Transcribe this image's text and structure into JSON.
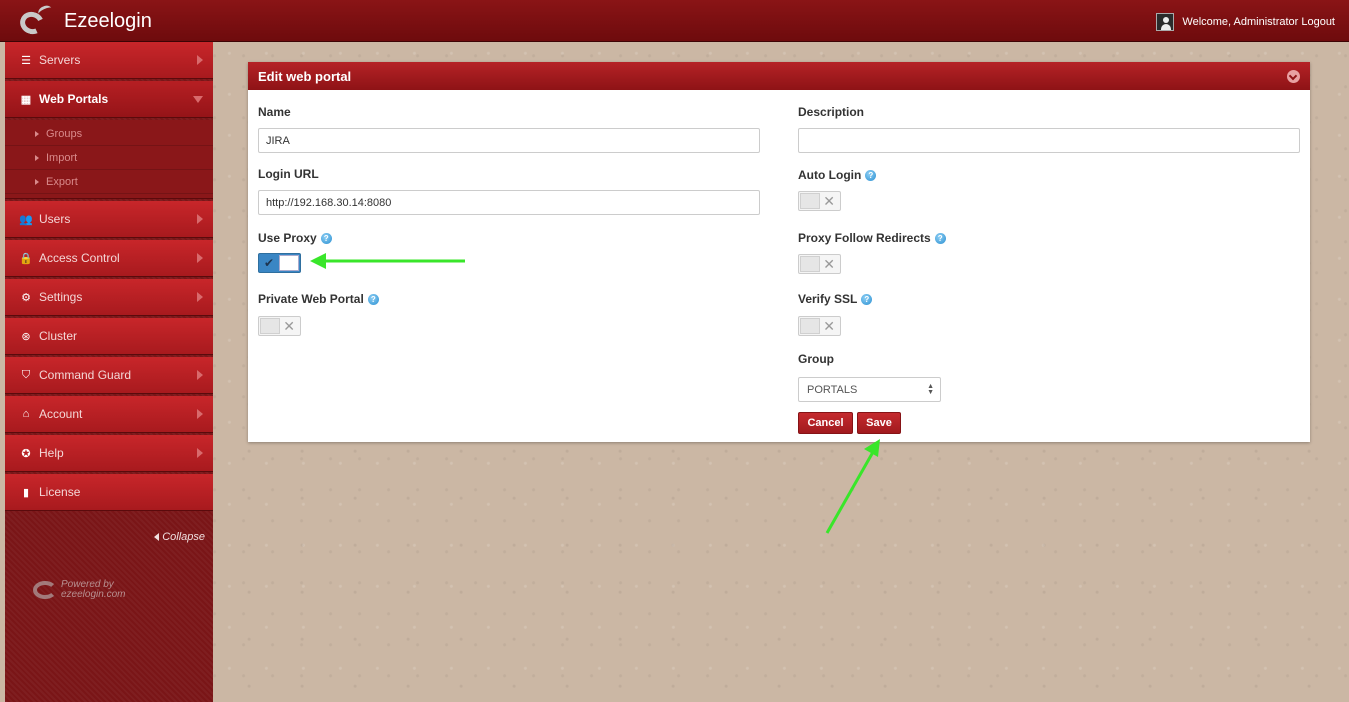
{
  "app": {
    "title": "Ezeelogin"
  },
  "header": {
    "welcome_text": "Welcome, Administrator",
    "logout_label": "Logout"
  },
  "sidebar": {
    "items": [
      {
        "label": "Servers",
        "icon": "list-icon"
      },
      {
        "label": "Web Portals",
        "icon": "dashboard-icon"
      },
      {
        "label": "Users",
        "icon": "users-icon"
      },
      {
        "label": "Access Control",
        "icon": "lock-icon"
      },
      {
        "label": "Settings",
        "icon": "cogs-icon"
      },
      {
        "label": "Cluster",
        "icon": "cluster-icon"
      },
      {
        "label": "Command Guard",
        "icon": "shield-icon"
      },
      {
        "label": "Account",
        "icon": "home-icon"
      },
      {
        "label": "Help",
        "icon": "lifebuoy-icon"
      },
      {
        "label": "License",
        "icon": "license-icon"
      }
    ],
    "subitems": [
      {
        "label": "Groups"
      },
      {
        "label": "Import"
      },
      {
        "label": "Export"
      }
    ],
    "collapse_label": "Collapse",
    "powered_by": "Powered by",
    "powered_site": "ezeelogin.com"
  },
  "panel": {
    "title": "Edit web portal",
    "fields": {
      "name_label": "Name",
      "name_value": "JIRA",
      "login_url_label": "Login URL",
      "login_url_value": "http://192.168.30.14:8080",
      "use_proxy_label": "Use Proxy",
      "use_proxy_on": true,
      "private_label": "Private Web Portal",
      "private_on": false,
      "description_label": "Description",
      "description_value": "",
      "auto_login_label": "Auto Login",
      "auto_login_on": false,
      "proxy_follow_label": "Proxy Follow Redirects",
      "proxy_follow_on": false,
      "verify_ssl_label": "Verify SSL",
      "verify_ssl_on": false,
      "group_label": "Group",
      "group_value": "PORTALS"
    },
    "cancel_label": "Cancel",
    "save_label": "Save"
  },
  "colors": {
    "primary": "#a81a1e",
    "annotation_arrow": "#39e62a",
    "toggle_on": "#3a86c4"
  }
}
